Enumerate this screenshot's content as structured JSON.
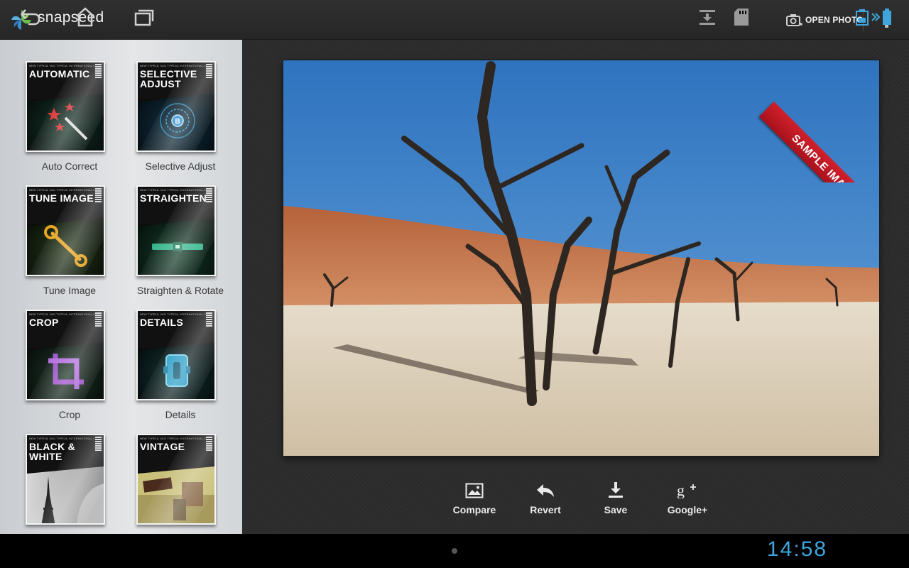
{
  "app": {
    "title": "snapseed",
    "logo_icon": "snapseed-logo-icon"
  },
  "topbar": {
    "open_photo_label": "OPEN PHOTO",
    "open_photo_icon": "camera-add-icon",
    "menu_icon": "overflow-menu-icon"
  },
  "sidebar": {
    "tools": [
      {
        "card_label": "AUTOMATIC",
        "name": "Auto Correct",
        "icon": "magic-wand-icon"
      },
      {
        "card_label": "SELECTIVE ADJUST",
        "name": "Selective Adjust",
        "icon": "control-point-icon"
      },
      {
        "card_label": "TUNE IMAGE",
        "name": "Tune Image",
        "icon": "wrench-icon"
      },
      {
        "card_label": "STRAIGHTEN",
        "name": "Straighten & Rotate",
        "icon": "level-icon"
      },
      {
        "card_label": "CROP",
        "name": "Crop",
        "icon": "crop-icon"
      },
      {
        "card_label": "DETAILS",
        "name": "Details",
        "icon": "sharpener-icon"
      },
      {
        "card_label": "BLACK & WHITE",
        "name": "",
        "icon": "eiffel-tower-photo"
      },
      {
        "card_label": "VINTAGE",
        "name": "",
        "icon": "vintage-photo"
      }
    ],
    "card_fine_print": "NEW TYPE18, NIJJ TYPE18, INTERNATIONAL 0"
  },
  "photo": {
    "ribbon_label": "SAMPLE IMAGE",
    "colors": {
      "sky": "#3d82c8",
      "dune": "#c9784a",
      "ground": "#d9cbb5",
      "ribbon": "#c41a24"
    }
  },
  "actions": [
    {
      "label": "Compare",
      "icon": "image-icon"
    },
    {
      "label": "Revert",
      "icon": "undo-arrow-icon"
    },
    {
      "label": "Save",
      "icon": "download-icon"
    },
    {
      "label": "Google+",
      "icon": "google-plus-icon"
    }
  ],
  "navbar": {
    "clock": "14:58",
    "accent": "#3ea6dd"
  }
}
